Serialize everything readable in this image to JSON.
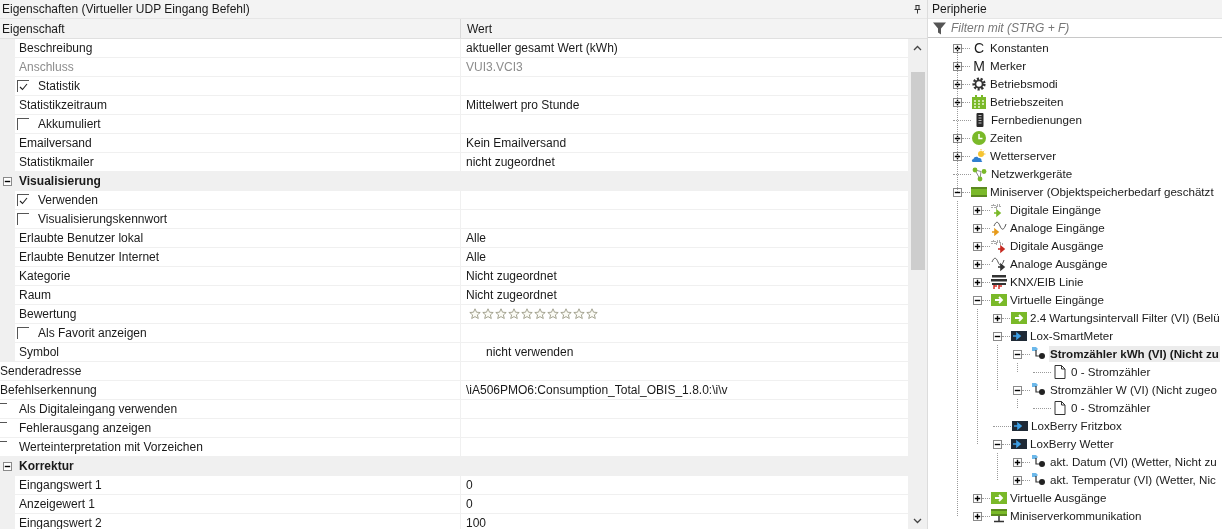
{
  "properties": {
    "title": "Eigenschaften (Virtueller UDP Eingang Befehl)",
    "columns": [
      "Eigenschaft",
      "Wert"
    ],
    "items": [
      {
        "kind": "continued",
        "children": [
          {
            "kind": "prop",
            "label": "Beschreibung",
            "value": "aktueller gesamt Wert (kWh)"
          },
          {
            "kind": "readonly",
            "label": "Anschluss",
            "value": "VUI3.VCI3"
          },
          {
            "kind": "check",
            "label": "Statistik",
            "checked": true
          },
          {
            "kind": "prop",
            "label": "Statistikzeitraum",
            "value": "Mittelwert pro Stunde"
          },
          {
            "kind": "check",
            "label": "Akkumuliert",
            "checked": false
          },
          {
            "kind": "prop",
            "label": "Emailversand",
            "value": "Kein Emailversand"
          },
          {
            "kind": "prop",
            "label": "Statistikmailer",
            "value": "nicht zugeordnet"
          }
        ]
      },
      {
        "kind": "group",
        "label": "Visualisierung",
        "expanded": true,
        "children": [
          {
            "kind": "check",
            "label": "Verwenden",
            "checked": true
          },
          {
            "kind": "check",
            "label": "Visualisierungskennwort",
            "checked": false
          },
          {
            "kind": "prop",
            "label": "Erlaubte Benutzer lokal",
            "value": "Alle"
          },
          {
            "kind": "prop",
            "label": "Erlaubte Benutzer Internet",
            "value": "Alle"
          },
          {
            "kind": "prop",
            "label": "Kategorie",
            "value": "Nicht zugeordnet"
          },
          {
            "kind": "prop",
            "label": "Raum",
            "value": "Nicht zugeordnet"
          },
          {
            "kind": "stars",
            "label": "Bewertung",
            "stars": 0
          },
          {
            "kind": "check",
            "label": "Als Favorit anzeigen",
            "checked": false
          },
          {
            "kind": "symbol",
            "label": "Symbol",
            "value": "nicht verwenden"
          }
        ]
      },
      {
        "kind": "prop",
        "label": "Senderadresse"
      },
      {
        "kind": "prop",
        "label": "Befehlserkennung",
        "value": "\\iA506PMO6:Consumption_Total_OBIS_1.8.0:\\i\\v"
      },
      {
        "kind": "check",
        "label": "Als Digitaleingang verwenden",
        "checked": false
      },
      {
        "kind": "check",
        "label": "Fehlerausgang anzeigen",
        "checked": false
      },
      {
        "kind": "check",
        "label": "Werteinterpretation mit Vorzeichen",
        "checked": false
      },
      {
        "kind": "group",
        "label": "Korrektur",
        "expanded": true,
        "children": [
          {
            "kind": "prop",
            "label": "Eingangswert 1",
            "value": "0"
          },
          {
            "kind": "prop",
            "label": "Anzeigewert 1",
            "value": "0"
          },
          {
            "kind": "prop",
            "label": "Eingangswert 2",
            "value": "100"
          }
        ]
      }
    ]
  },
  "periphery": {
    "title": "Peripherie",
    "filter": {
      "placeholder": "Filtern mit (STRG + F)"
    },
    "nodes": [
      {
        "label": "Konstanten",
        "kind": "letter",
        "glyph": "C",
        "expanded": false,
        "selected": false
      },
      {
        "label": "Merker",
        "kind": "letter",
        "glyph": "M",
        "expanded": false,
        "selected": false
      },
      {
        "label": "Betriebsmodi",
        "kind": "modes",
        "expanded": false,
        "selected": false
      },
      {
        "label": "Betriebszeiten",
        "kind": "calendar",
        "expanded": false,
        "selected": false
      },
      {
        "label": "Fernbedienungen",
        "kind": "remote",
        "selected": false
      },
      {
        "label": "Zeiten",
        "kind": "clock",
        "expanded": false,
        "selected": false
      },
      {
        "label": "Wetterserver",
        "kind": "weather",
        "expanded": false,
        "selected": false
      },
      {
        "label": "Netzwerkgeräte",
        "kind": "network",
        "selected": false
      },
      {
        "label": "Miniserver (Objektspeicherbedarf geschätzt",
        "kind": "server",
        "expanded": true,
        "selected": false,
        "children": [
          {
            "label": "Digitale Eingänge",
            "kind": "digital-in",
            "expanded": false,
            "selected": false
          },
          {
            "label": "Analoge Eingänge",
            "kind": "analog-in",
            "expanded": false,
            "selected": false
          },
          {
            "label": "Digitale Ausgänge",
            "kind": "digital-out",
            "expanded": false,
            "selected": false
          },
          {
            "label": "Analoge Ausgänge",
            "kind": "analog-out",
            "expanded": false,
            "selected": false
          },
          {
            "label": "KNX/EIB Linie",
            "kind": "knx",
            "expanded": false,
            "selected": false
          },
          {
            "label": "Virtuelle Eingänge",
            "kind": "virtual-in",
            "expanded": true,
            "selected": false,
            "children": [
              {
                "label": "2.4 Wartungsintervall Filter (VI) (Belü",
                "kind": "virtual-in",
                "expanded": false,
                "selected": false
              },
              {
                "label": "Lox-SmartMeter",
                "kind": "udp-in",
                "expanded": true,
                "selected": false,
                "children": [
                  {
                    "label": "Stromzähler kWh (VI) (Nicht zu",
                    "kind": "input",
                    "expanded": true,
                    "selected": true,
                    "children": [
                      {
                        "label": "0 - Stromzähler",
                        "kind": "command",
                        "selected": false
                      }
                    ]
                  },
                  {
                    "label": "Stromzähler W (VI) (Nicht zugeo",
                    "kind": "input",
                    "expanded": true,
                    "selected": false,
                    "children": [
                      {
                        "label": "0 - Stromzähler",
                        "kind": "command",
                        "selected": false
                      }
                    ]
                  }
                ]
              },
              {
                "label": "LoxBerry Fritzbox",
                "kind": "udp-in",
                "selected": false
              },
              {
                "label": "LoxBerry Wetter",
                "kind": "udp-in",
                "expanded": true,
                "selected": false,
                "children": [
                  {
                    "label": "akt. Datum (VI) (Wetter, Nicht zu",
                    "kind": "input",
                    "expanded": false,
                    "selected": false
                  },
                  {
                    "label": "akt. Temperatur (VI) (Wetter, Nic",
                    "kind": "input",
                    "expanded": false,
                    "selected": false
                  }
                ]
              }
            ]
          },
          {
            "label": "Virtuelle Ausgänge",
            "kind": "virtual-out",
            "expanded": false,
            "selected": false
          },
          {
            "label": "Miniserverkommunikation",
            "kind": "link",
            "expanded": false,
            "selected": false
          }
        ]
      }
    ]
  }
}
